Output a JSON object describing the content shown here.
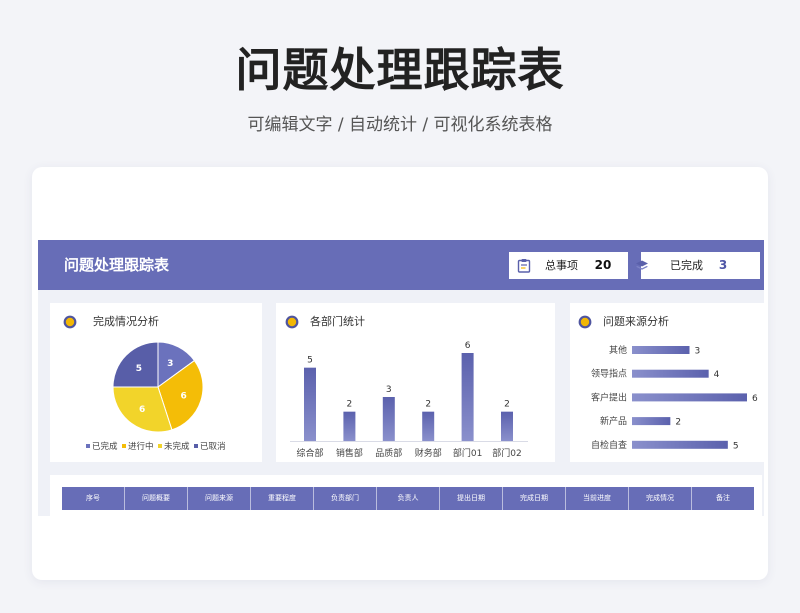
{
  "page": {
    "title": "问题处理跟踪表",
    "subtitle": "可编辑文字 / 自动统计 / 可视化系统表格"
  },
  "dashboard": {
    "header_title": "问题处理跟踪表",
    "kpis": [
      {
        "label": "总事项",
        "value": "20",
        "icon": "clipboard-icon"
      },
      {
        "label": "已完成",
        "value": "3",
        "icon": "layers-icon"
      }
    ]
  },
  "icons": {
    "panel_bullet": "circle-bullet-icon"
  },
  "table": {
    "columns": [
      "序号",
      "问题概要",
      "问题来源",
      "重要程度",
      "负责部门",
      "负责人",
      "提出日期",
      "完成日期",
      "当前进度",
      "完成情况",
      "备注"
    ]
  },
  "colors": {
    "accent": "#676db7",
    "kpi_highlight": "#4f56a6",
    "bullet_fill": "#f2b705",
    "pie": [
      "#6b72bd",
      "#f4bd07",
      "#f2d42a",
      "#585ea8"
    ],
    "bar": "#676db7"
  },
  "chart_data": [
    {
      "type": "pie",
      "title": "完成情况分析",
      "categories": [
        "已完成",
        "进行中",
        "未完成",
        "已取消"
      ],
      "values": [
        3,
        6,
        6,
        5
      ],
      "legend": "bottom"
    },
    {
      "type": "bar",
      "title": "各部门统计",
      "categories": [
        "综合部",
        "销售部",
        "品质部",
        "财务部",
        "部门01",
        "部门02"
      ],
      "values": [
        5,
        2,
        3,
        2,
        6,
        2
      ],
      "grid": false
    },
    {
      "type": "bar",
      "orientation": "horizontal",
      "title": "问题来源分析",
      "categories": [
        "其他",
        "领导指点",
        "客户提出",
        "新产品",
        "自检自查"
      ],
      "values": [
        3,
        4,
        6,
        2,
        5
      ],
      "grid": false
    }
  ]
}
